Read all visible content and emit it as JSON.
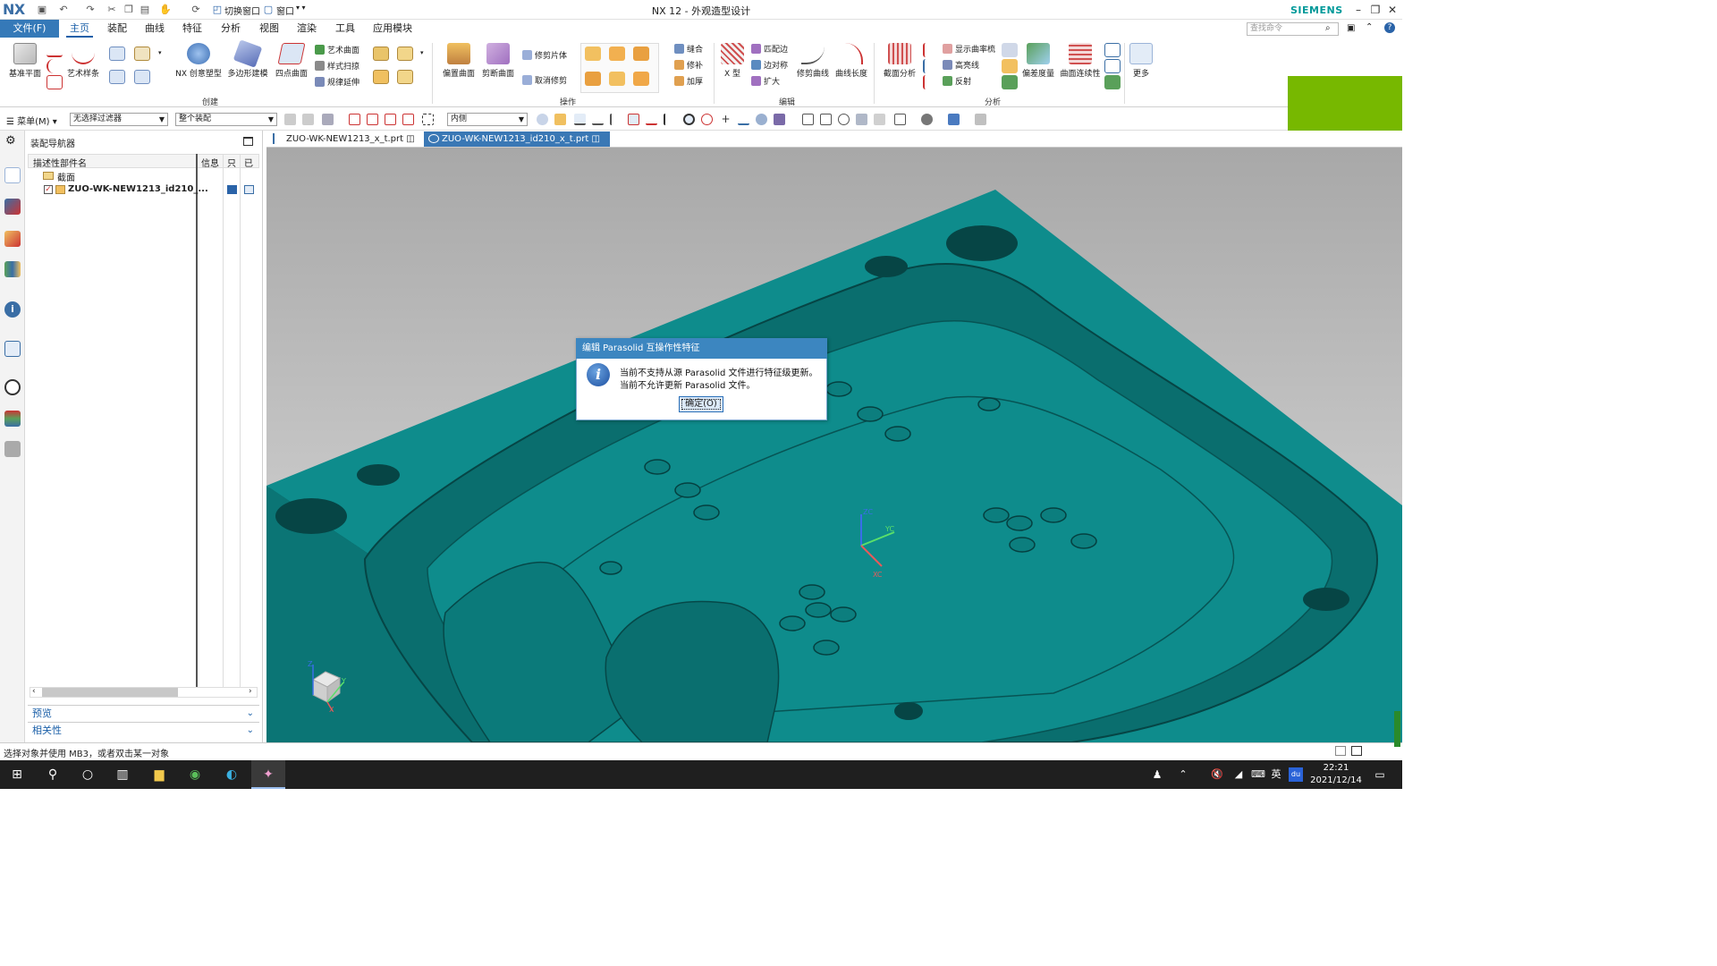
{
  "app": {
    "logo": "NX",
    "window_title": "NX 12 - 外观造型设计",
    "brand": "SIEMENS",
    "quick_access": {
      "switch_window": "切换窗口",
      "window": "窗口"
    }
  },
  "menu": {
    "file": "文件(F)",
    "tabs": [
      "主页",
      "装配",
      "曲线",
      "特征",
      "分析",
      "视图",
      "渲染",
      "工具",
      "应用模块"
    ],
    "active_tab": "主页",
    "search_placeholder": "查找命令"
  },
  "ribbon": {
    "groups": {
      "create": "创建",
      "operate": "操作",
      "edit": "编辑",
      "analyze": "分析"
    },
    "create": {
      "datum_plane": "基准平面",
      "art_spline": "艺术样条",
      "nx_creative": "NX 创意塑型",
      "polygon_model": "多边形建模",
      "four_point": "四点曲面",
      "art_surface": "艺术曲面",
      "styled_sweep": "样式扫掠",
      "law_extension": "规律延伸"
    },
    "operate": {
      "offset_surface": "偏置曲面",
      "trim_surface": "剪断曲面",
      "trim_sheet": "修剪片体",
      "untrim": "取消修剪",
      "sew": "缝合",
      "patch": "修补",
      "thicken": "加厚"
    },
    "edit": {
      "x_form": "X 型",
      "match_edge": "匹配边",
      "edge_symmetry": "边对称",
      "enlarge": "扩大",
      "trim_curve": "修剪曲线",
      "curve_length": "曲线长度"
    },
    "analyze": {
      "section_analysis": "截面分析",
      "show_curvature_comb": "显示曲率梳",
      "highlight_lines": "高亮线",
      "reflection": "反射",
      "deviation_measure": "偏差度量",
      "surface_continuity": "曲面连续性",
      "more": "更多"
    }
  },
  "toolbar2": {
    "menu": "菜单(M)",
    "filter": "无选择过滤器",
    "scope": "整个装配",
    "inside": "内侧"
  },
  "navigator": {
    "title": "装配导航器",
    "columns": [
      "描述性部件名",
      "信息",
      "只",
      "已"
    ],
    "rows": [
      {
        "label": "截面",
        "bold": false
      },
      {
        "label": "ZUO-WK-NEW1213_id210_...",
        "bold": true
      }
    ],
    "sections": [
      "预览",
      "相关性"
    ]
  },
  "documents": {
    "tabs": [
      {
        "label": "ZUO-WK-NEW1213_x_t.prt",
        "active": false
      },
      {
        "label": "ZUO-WK-NEW1213_id210_x_t.prt",
        "active": true
      }
    ]
  },
  "viewport": {
    "axis_labels": {
      "zc": "ZC",
      "yc": "YC",
      "xc": "XC",
      "z": "Z",
      "y": "Y",
      "x": "X"
    },
    "model_color": "#0e8c8c"
  },
  "dialog": {
    "title": "编辑 Parasolid 互操作性特征",
    "line1": "当前不支持从源 Parasolid 文件进行特征级更新。",
    "line2": "当前不允许更新 Parasolid 文件。",
    "ok": "确定(O)"
  },
  "status": {
    "text": "选择对象并使用 MB3，或者双击某一对象"
  },
  "taskbar": {
    "time": "22:21",
    "date": "2021/12/14",
    "ime": "英"
  }
}
